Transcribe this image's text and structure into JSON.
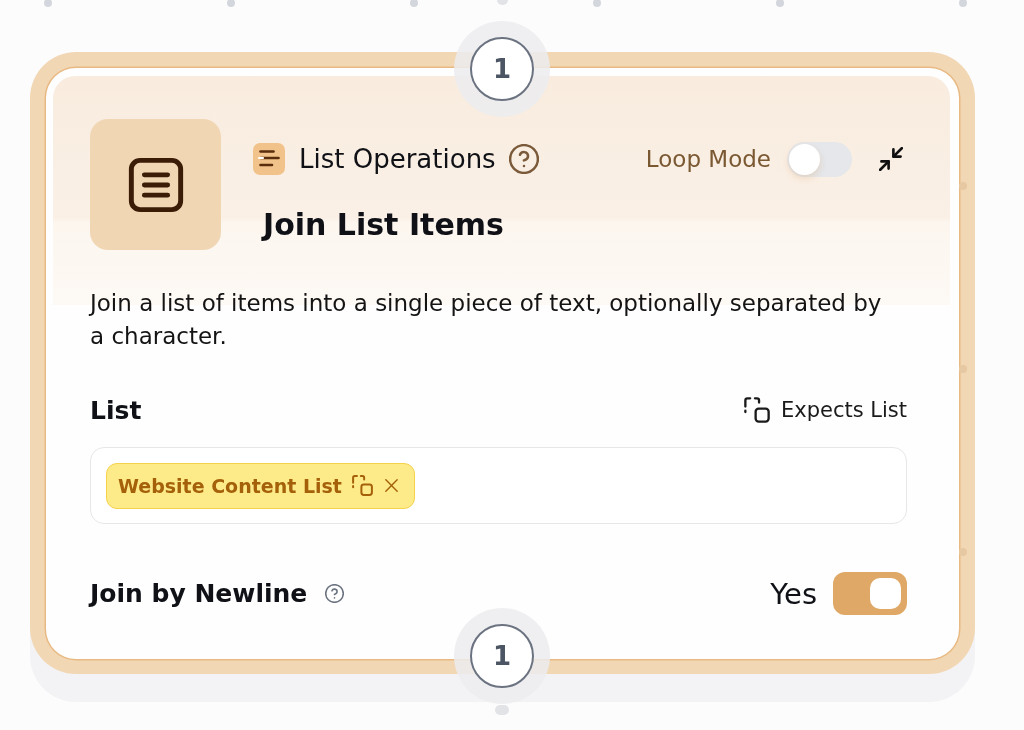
{
  "input_port": {
    "label": "1"
  },
  "output_port": {
    "label": "1"
  },
  "node": {
    "category": "List Operations",
    "title": "Join List Items",
    "loop_mode": {
      "label": "Loop Mode",
      "on": false
    },
    "description": "Join a list of items into a single piece of text, optionally separated by a character.",
    "fields": [
      {
        "kind": "list",
        "label": "List",
        "hint": "Expects List",
        "chips": [
          {
            "label": "Website Content List"
          }
        ]
      },
      {
        "kind": "toggle",
        "label": "Join by Newline",
        "value_label": "Yes",
        "on": true
      }
    ]
  }
}
